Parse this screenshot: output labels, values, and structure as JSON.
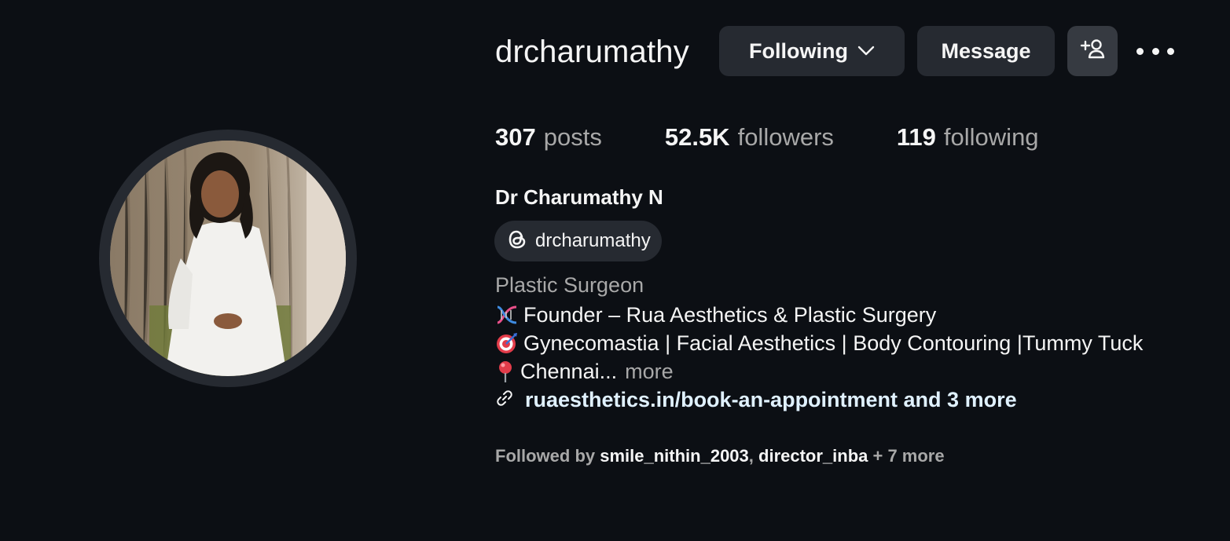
{
  "profile": {
    "username": "drcharumathy",
    "full_name": "Dr Charumathy N",
    "avatar_icon": "profile-photo"
  },
  "actions": {
    "following_label": "Following",
    "message_label": "Message",
    "add_user_icon": "add-user-icon",
    "more_icon": "more-options-icon"
  },
  "stats": {
    "posts_count": "307",
    "posts_label": "posts",
    "followers_count": "52.5K",
    "followers_label": "followers",
    "following_count": "119",
    "following_label": "following"
  },
  "threads": {
    "handle": "drcharumathy",
    "icon": "threads-icon"
  },
  "bio": {
    "category": "Plastic Surgeon",
    "line1": "Founder – Rua Aesthetics & Plastic Surgery",
    "line1_emoji": "dna-emoji",
    "line2": "Gynecomastia | Facial Aesthetics | Body Contouring |Tummy Tuck",
    "line2_emoji": "target-emoji",
    "line3": "Chennai...",
    "line3_emoji": "pin-emoji",
    "more_label": "more",
    "link_text": "ruaesthetics.in/book-an-appointment and 3 more",
    "link_icon": "link-icon"
  },
  "followed_by": {
    "prefix": "Followed by ",
    "account1": "smile_nithin_2003",
    "separator": ", ",
    "account2": "director_inba",
    "suffix": " + 7 more"
  },
  "colors": {
    "background": "#0c0f14",
    "button": "#262a31",
    "secondary_text": "#a8a8a8",
    "link": "#e0f1ff"
  }
}
